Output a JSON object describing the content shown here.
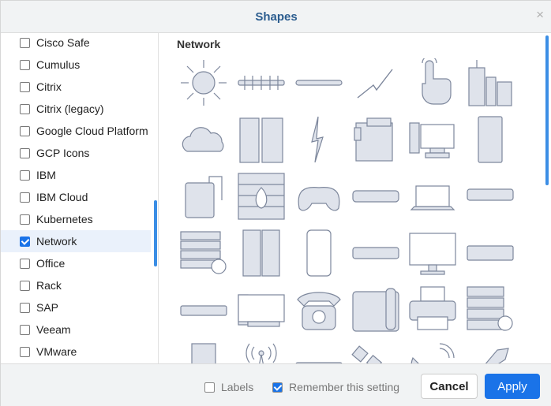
{
  "dialog": {
    "title": "Shapes",
    "close_icon": "×"
  },
  "sidebar": {
    "items": [
      {
        "label": "Cisco Safe",
        "checked": false
      },
      {
        "label": "Cumulus",
        "checked": false
      },
      {
        "label": "Citrix",
        "checked": false
      },
      {
        "label": "Citrix (legacy)",
        "checked": false
      },
      {
        "label": "Google Cloud Platform",
        "checked": false
      },
      {
        "label": "GCP Icons",
        "checked": false
      },
      {
        "label": "IBM",
        "checked": false
      },
      {
        "label": "IBM Cloud",
        "checked": false
      },
      {
        "label": "Kubernetes",
        "checked": false
      },
      {
        "label": "Network",
        "checked": true
      },
      {
        "label": "Office",
        "checked": false
      },
      {
        "label": "Rack",
        "checked": false
      },
      {
        "label": "SAP",
        "checked": false
      },
      {
        "label": "Veeam",
        "checked": false
      },
      {
        "label": "VMware",
        "checked": false
      }
    ]
  },
  "main": {
    "section_title": "Network",
    "shape_icons": [
      "bus-icon",
      "comm-link-icon",
      "cable-icon",
      "lightning-link-icon",
      "touch-icon",
      "city-icon",
      "cloud-icon",
      "buildings-icon",
      "lightning-bolt-icon",
      "copier-icon",
      "workstation-icon",
      "server-tower-icon",
      "external-drive-icon",
      "firewall-icon",
      "gamepad-icon",
      "modem-icon",
      "laptop-icon",
      "switch-icon",
      "storage-icon",
      "server-rack-icon",
      "mobile-icon",
      "router-icon",
      "monitor-icon",
      "rack-server-icon",
      "hub-icon",
      "desktop-pc-icon",
      "phone-icon",
      "ip-phone-icon",
      "printer-icon",
      "mail-server-icon",
      "tower-server-icon",
      "radio-tower-icon",
      "nas-icon",
      "satellite-icon",
      "satellite-dish-icon",
      "uplink-icon"
    ]
  },
  "footer": {
    "labels_option": "Labels",
    "labels_checked": false,
    "remember_option": "Remember this setting",
    "remember_checked": true,
    "cancel_label": "Cancel",
    "apply_label": "Apply"
  },
  "colors": {
    "accent": "#1a73e8",
    "title": "#2c5d8f",
    "shape_fill": "#dfe3eb",
    "shape_stroke": "#7d879c"
  }
}
